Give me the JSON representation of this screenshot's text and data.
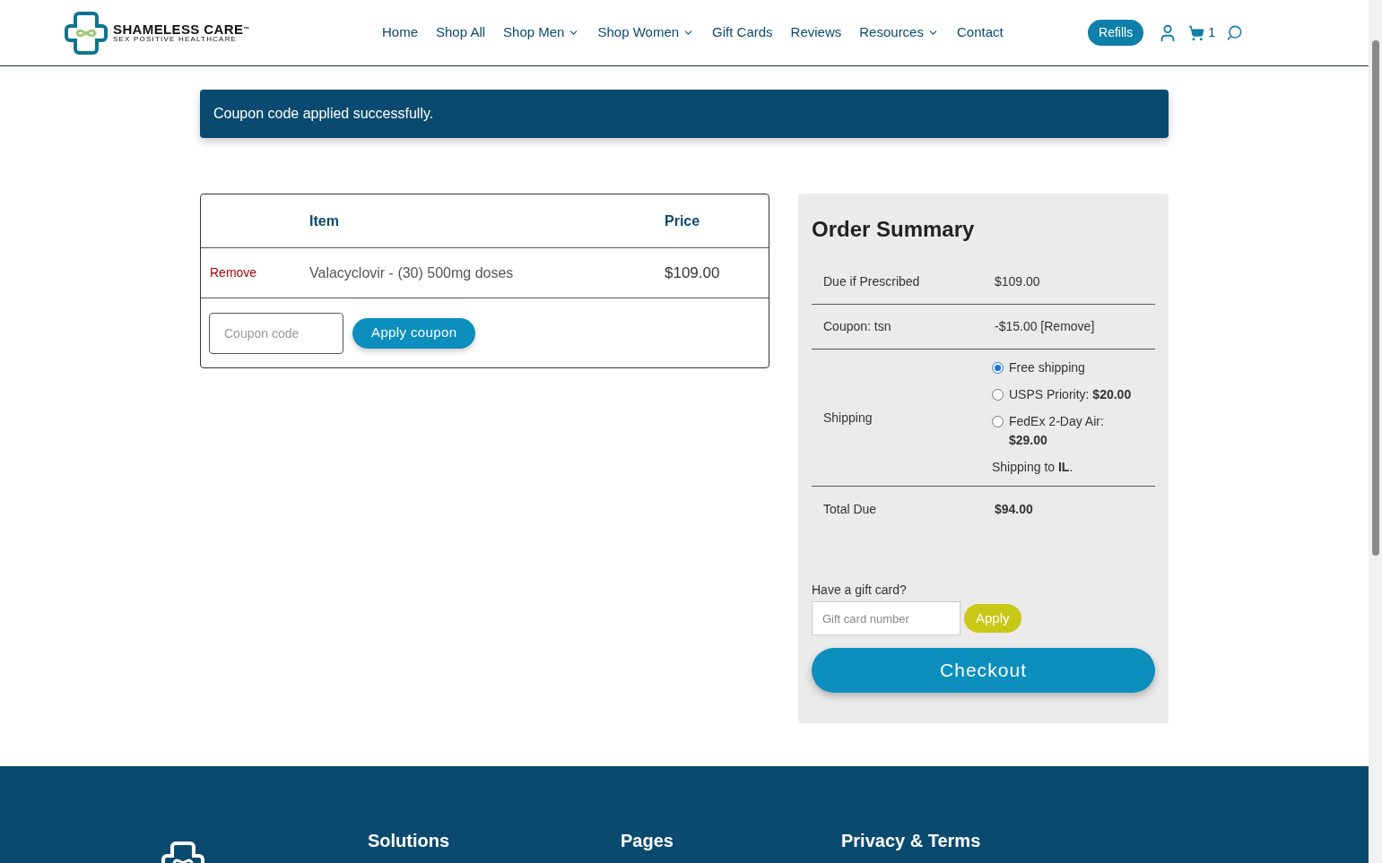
{
  "header": {
    "logo": {
      "name": "SHAMELESS CARE",
      "mark": "™",
      "tagline": "SEX POSITIVE HEALTHCARE"
    },
    "nav": [
      {
        "label": "Home",
        "dropdown": false
      },
      {
        "label": "Shop All",
        "dropdown": false
      },
      {
        "label": "Shop Men",
        "dropdown": true
      },
      {
        "label": "Shop Women",
        "dropdown": true
      },
      {
        "label": "Gift Cards",
        "dropdown": false
      },
      {
        "label": "Reviews",
        "dropdown": false
      },
      {
        "label": "Resources",
        "dropdown": true
      },
      {
        "label": "Contact",
        "dropdown": false
      }
    ],
    "refills_button": "Refills",
    "cart_count": "1"
  },
  "notice": "Coupon code applied successfully.",
  "cart": {
    "columns": [
      "Item",
      "Price"
    ],
    "rows": [
      {
        "remove": "Remove",
        "item": "Valacyclovir - (30) 500mg doses",
        "price": "$109.00"
      }
    ],
    "coupon": {
      "placeholder": "Coupon code",
      "button": "Apply coupon"
    }
  },
  "summary": {
    "title": "Order Summary",
    "rows": [
      {
        "kind": "text",
        "label": "Due if Prescribed",
        "value": "$109.00"
      },
      {
        "kind": "text",
        "label": "Coupon: tsn",
        "value": "-$15.00 [Remove]"
      },
      {
        "kind": "shipping",
        "label": "Shipping",
        "options": [
          {
            "label": "Free shipping",
            "selected": true
          },
          {
            "label": "USPS Priority: **$20.00**",
            "selected": false
          },
          {
            "label": "FedEx 2-Day Air: **$29.00**",
            "selected": false
          }
        ],
        "note": "Shipping to **IL**."
      },
      {
        "kind": "total",
        "label": "Total Due",
        "value": "$94.00"
      }
    ],
    "gift_card": {
      "label": "Have a gift card?",
      "placeholder": "Gift card number",
      "button": "Apply"
    },
    "checkout": "Checkout"
  },
  "footer": {
    "headings": [
      "Solutions",
      "Pages",
      "Privacy & Terms"
    ]
  }
}
